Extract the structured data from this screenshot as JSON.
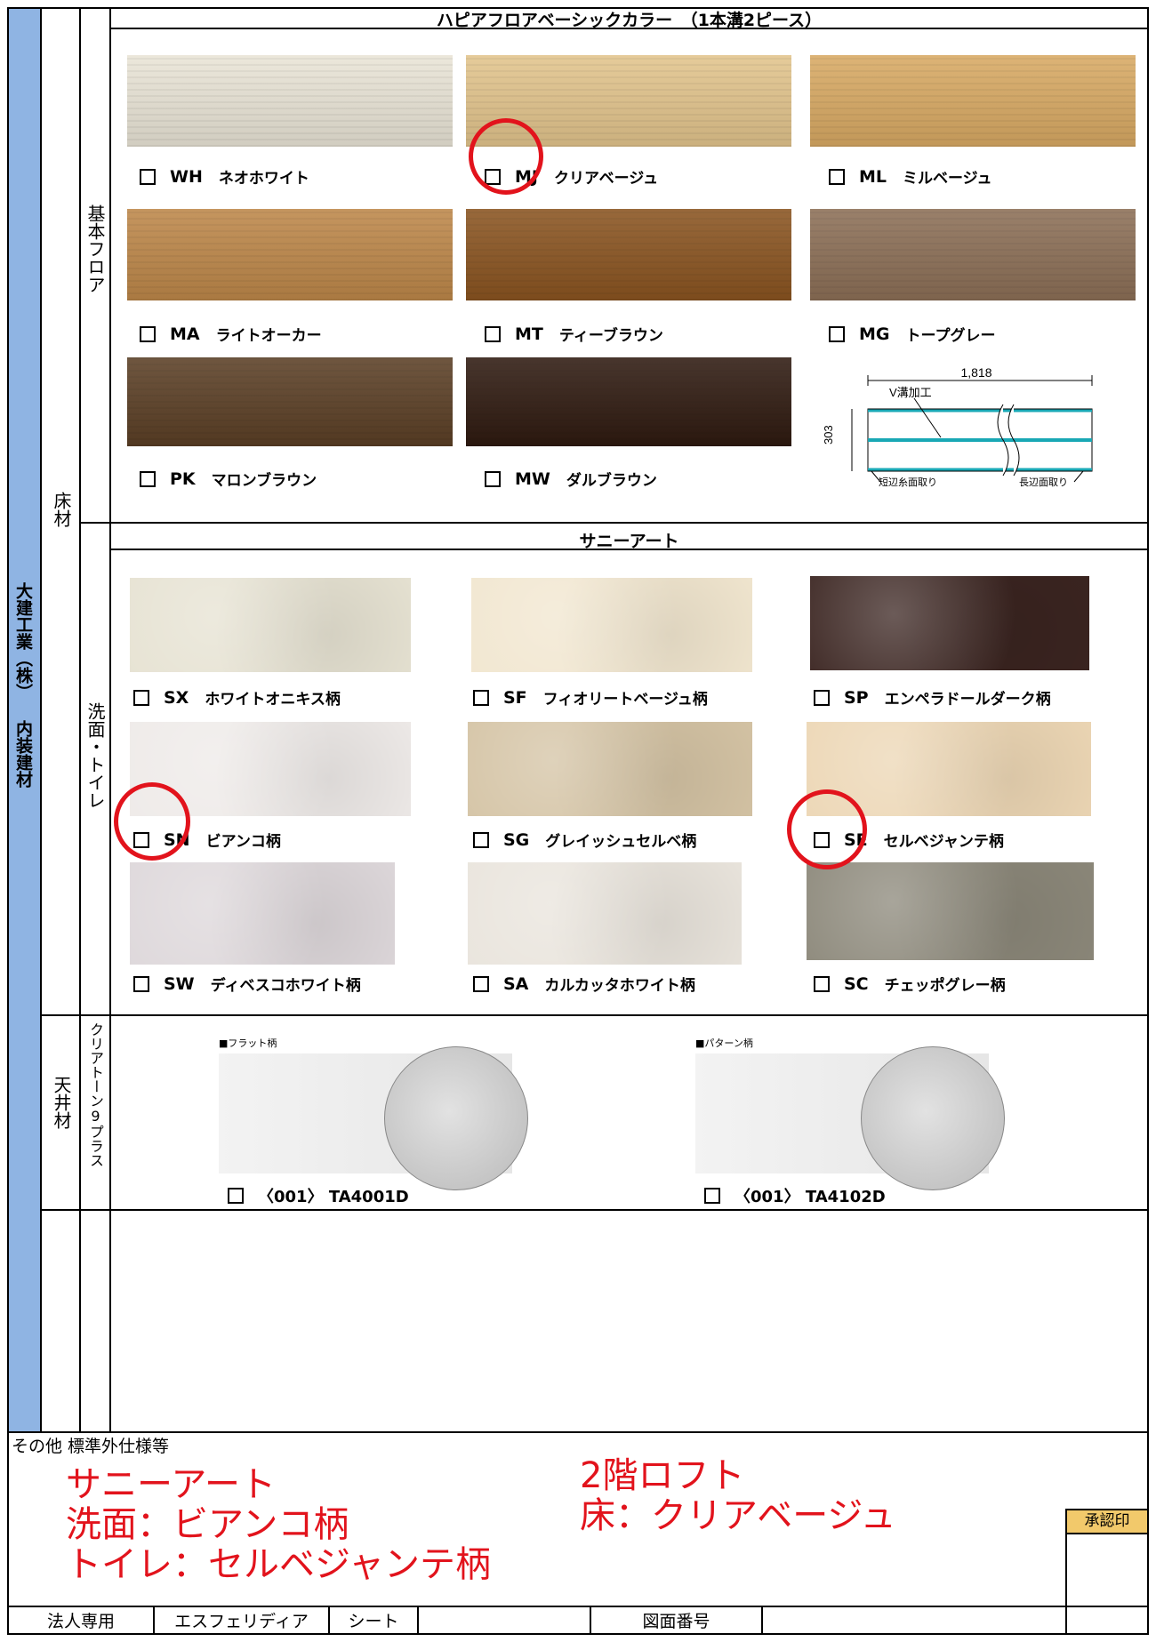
{
  "side_label": "大建工業（株） 内装建材",
  "floor": {
    "category": "床材",
    "subcategory": "基本フロア",
    "section_title": "ハピアフロアベーシックカラー　（1本溝2ピース）",
    "items": [
      {
        "code": "WH",
        "name": "ネオホワイト",
        "color": "#e9e4d6"
      },
      {
        "code": "MJ",
        "name": "クリアベージュ",
        "color": "#e2c48c"
      },
      {
        "code": "ML",
        "name": "ミルベージュ",
        "color": "#d8a963"
      },
      {
        "code": "MA",
        "name": "ライトオーカー",
        "color": "#bd8749"
      },
      {
        "code": "MT",
        "name": "ティーブラウン",
        "color": "#8a5420"
      },
      {
        "code": "MG",
        "name": "トープグレー",
        "color": "#8c6f56"
      },
      {
        "code": "PK",
        "name": "マロンブラウン",
        "color": "#5b3f25"
      },
      {
        "code": "MW",
        "name": "ダルブラウン",
        "color": "#2f1a10"
      }
    ],
    "diagram": {
      "width_label": "1,818",
      "height_label": "303",
      "groove_label": "V溝加工",
      "short_edge_label": "短辺糸面取り",
      "long_edge_label": "長辺面取り"
    }
  },
  "sunny": {
    "subcategory": "洗面・トイレ",
    "section_title": "サニーアート",
    "items": [
      {
        "code": "SX",
        "name": "ホワイトオニキス柄",
        "color": "#e6e2d2"
      },
      {
        "code": "SF",
        "name": "フィオリートベージュ柄",
        "color": "#f1e6cf"
      },
      {
        "code": "SP",
        "name": "エンペラドールダーク柄",
        "color": "#3a2420"
      },
      {
        "code": "SN",
        "name": "ビアンコ柄",
        "color": "#eeeae8"
      },
      {
        "code": "SG",
        "name": "グレイッシュセルベ柄",
        "color": "#d4c3a4"
      },
      {
        "code": "SE",
        "name": "セルベジャンテ柄",
        "color": "#ecd6b4"
      },
      {
        "code": "SW",
        "name": "ディベスコホワイト柄",
        "color": "#ddd7da"
      },
      {
        "code": "SA",
        "name": "カルカッタホワイト柄",
        "color": "#e9e4dc"
      },
      {
        "code": "SC",
        "name": "チェッポグレー柄",
        "color": "#8b8779"
      }
    ]
  },
  "ceiling": {
    "category": "天井材",
    "subcategory": "クリアトーン9プラス",
    "items": [
      {
        "heading": "■フラット柄",
        "label": "〈001〉 TA4001D"
      },
      {
        "heading": "■パターン柄",
        "label": "〈001〉 TA4102D"
      }
    ]
  },
  "notes": {
    "label": "その他 標準外仕様等",
    "left_lines": [
      "サニーアート",
      "洗面：ビアンコ柄",
      "トイレ：セルベジャンテ柄"
    ],
    "right_lines": [
      "2階ロフト",
      "床：クリアベージュ"
    ],
    "stamp_label": "承認印"
  },
  "footer": {
    "corporate": "法人専用",
    "product": "エスフェリディア",
    "sheet": "シート",
    "drawing_number": "図面番号"
  },
  "colors": {
    "accent_blue": "#8fb4e3",
    "markup_red": "#e2131c"
  }
}
